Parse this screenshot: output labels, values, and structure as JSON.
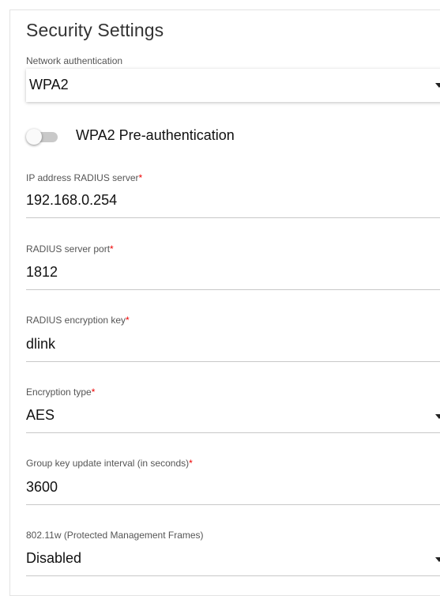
{
  "section": {
    "title": "Security Settings"
  },
  "network_authentication": {
    "label": "Network authentication",
    "value": "WPA2"
  },
  "preauth": {
    "label": "WPA2 Pre-authentication",
    "enabled": false
  },
  "radius_ip": {
    "label": "IP address RADIUS server",
    "required_mark": "*",
    "value": "192.168.0.254"
  },
  "radius_port": {
    "label": "RADIUS server port",
    "required_mark": "*",
    "value": "1812"
  },
  "radius_key": {
    "label": "RADIUS encryption key",
    "required_mark": "*",
    "value": "dlink"
  },
  "encryption_type": {
    "label": "Encryption type",
    "required_mark": "*",
    "value": "AES"
  },
  "group_key_interval": {
    "label": "Group key update interval (in seconds)",
    "required_mark": "*",
    "value": "3600"
  },
  "pmf": {
    "label": "802.11w (Protected Management Frames)",
    "value": "Disabled"
  },
  "colors": {
    "required": "#ee0000",
    "toggle_track": "#c9c9c9",
    "divider": "#c8c8c8"
  }
}
